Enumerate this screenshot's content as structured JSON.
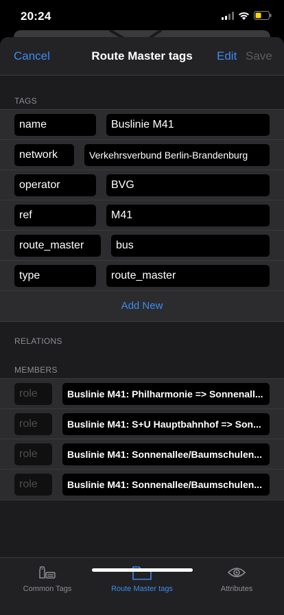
{
  "status": {
    "time": "20:24"
  },
  "nav": {
    "cancel": "Cancel",
    "title": "Route Master tags",
    "edit": "Edit",
    "save": "Save"
  },
  "tags": {
    "header": "TAGS",
    "rows": [
      {
        "key": "name",
        "value": "Buslinie M41"
      },
      {
        "key": "network",
        "value": "Verkehrsverbund Berlin-Brandenburg"
      },
      {
        "key": "operator",
        "value": "BVG"
      },
      {
        "key": "ref",
        "value": "M41"
      },
      {
        "key": "route_master",
        "value": "bus"
      },
      {
        "key": "type",
        "value": "route_master"
      }
    ],
    "add_new": "Add New"
  },
  "relations": {
    "header": "RELATIONS"
  },
  "members": {
    "header": "MEMBERS",
    "rows": [
      {
        "role": "role",
        "value": "Buslinie M41: Philharmonie => Sonnenall..."
      },
      {
        "role": "role",
        "value": "Buslinie M41: S+U Hauptbahnhof => Son..."
      },
      {
        "role": "role",
        "value": "Buslinie M41: Sonnenallee/Baumschulen..."
      },
      {
        "role": "role",
        "value": "Buslinie M41: Sonnenallee/Baumschulen..."
      }
    ]
  },
  "tabbar": {
    "items": [
      {
        "label": "Common Tags",
        "icon": "tag-icon"
      },
      {
        "label": "Route Master tags",
        "icon": "folder-icon"
      },
      {
        "label": "Attributes",
        "icon": "eye-icon"
      }
    ],
    "active_index": 1
  },
  "colors": {
    "accent": "#3b8cf0",
    "background": "#1c1c1e",
    "field": "#000000"
  }
}
